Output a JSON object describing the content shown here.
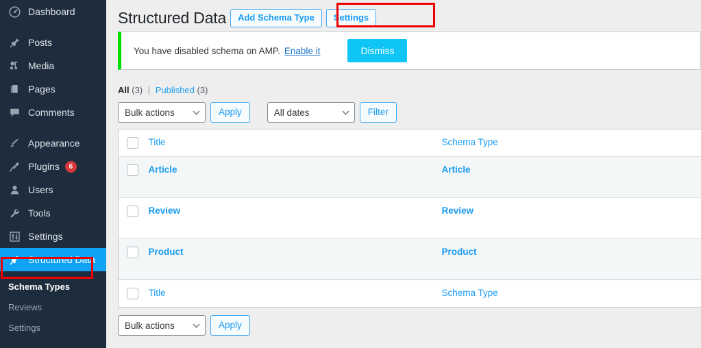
{
  "sidebar": {
    "items": [
      {
        "label": "Dashboard",
        "icon": "dashboard-icon",
        "badge": null,
        "current": false,
        "gap_after": true
      },
      {
        "label": "Posts",
        "icon": "pin-icon",
        "badge": null,
        "current": false,
        "gap_after": false
      },
      {
        "label": "Media",
        "icon": "media-icon",
        "badge": null,
        "current": false,
        "gap_after": false
      },
      {
        "label": "Pages",
        "icon": "pages-icon",
        "badge": null,
        "current": false,
        "gap_after": false
      },
      {
        "label": "Comments",
        "icon": "comments-icon",
        "badge": null,
        "current": false,
        "gap_after": true
      },
      {
        "label": "Appearance",
        "icon": "brush-icon",
        "badge": null,
        "current": false,
        "gap_after": false
      },
      {
        "label": "Plugins",
        "icon": "plug-icon",
        "badge": "6",
        "current": false,
        "gap_after": false
      },
      {
        "label": "Users",
        "icon": "user-icon",
        "badge": null,
        "current": false,
        "gap_after": false
      },
      {
        "label": "Tools",
        "icon": "wrench-icon",
        "badge": null,
        "current": false,
        "gap_after": false
      },
      {
        "label": "Settings",
        "icon": "sliders-icon",
        "badge": null,
        "current": false,
        "gap_after": false
      },
      {
        "label": "Structured Data",
        "icon": "pin-icon",
        "badge": null,
        "current": true,
        "gap_after": false
      }
    ],
    "submenu": [
      {
        "label": "Schema Types",
        "current": true
      },
      {
        "label": "Reviews",
        "current": false
      },
      {
        "label": "Settings",
        "current": false
      }
    ],
    "accent_current": "#0fa2f5",
    "background": "#1d2d3e"
  },
  "header": {
    "title": "Structured Data",
    "add_button": "Add Schema Type",
    "settings_button": "Settings"
  },
  "notice": {
    "message": "You have disabled schema on AMP.",
    "link": "Enable it",
    "dismiss": "Dismiss",
    "accent": "#00e000",
    "dismiss_color": "#0fc5f5"
  },
  "views": {
    "all_label": "All",
    "all_count": "(3)",
    "separator": "|",
    "published_label": "Published",
    "published_count": "(3)"
  },
  "tablenav_top": {
    "bulk_actions": "Bulk actions",
    "apply": "Apply",
    "dates": "All dates",
    "filter": "Filter"
  },
  "tablenav_bottom": {
    "bulk_actions": "Bulk actions",
    "apply": "Apply"
  },
  "table": {
    "columns": {
      "title": "Title",
      "schema_type": "Schema Type"
    },
    "rows": [
      {
        "title": "Article",
        "schema_type": "Article"
      },
      {
        "title": "Review",
        "schema_type": "Review"
      },
      {
        "title": "Product",
        "schema_type": "Product"
      }
    ]
  },
  "annotations": {
    "add_button_box": "#ee0000",
    "sidebar_item_box": "#ee0000"
  }
}
